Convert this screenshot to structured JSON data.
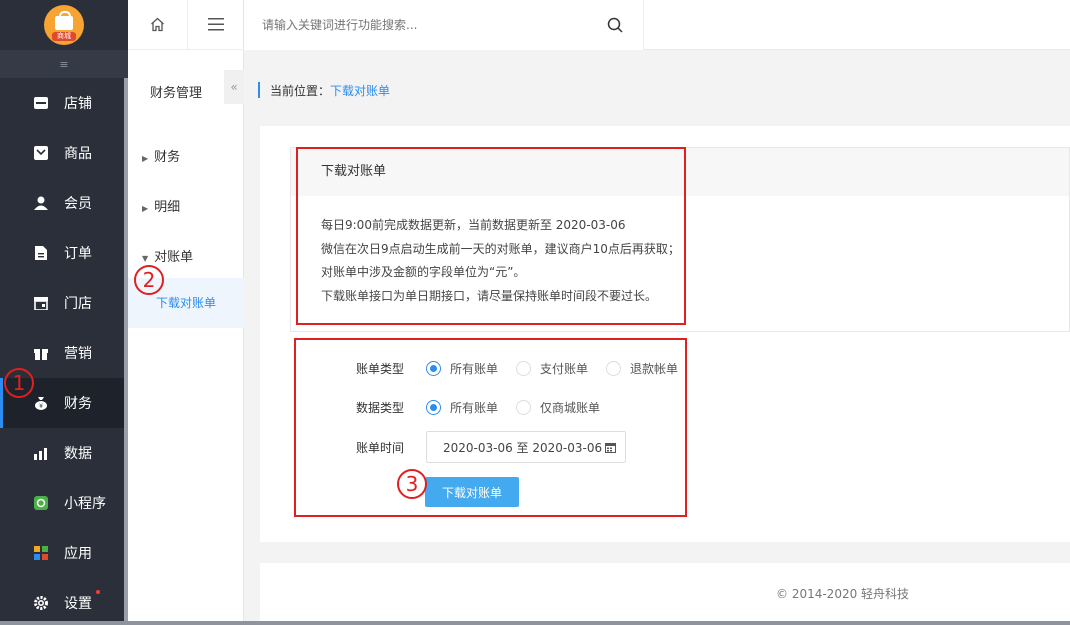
{
  "logo": {
    "tag": "商城"
  },
  "nav": {
    "collapse_icon": "≡",
    "items": [
      {
        "label": "店铺",
        "icon": "store-icon"
      },
      {
        "label": "商品",
        "icon": "goods-icon"
      },
      {
        "label": "会员",
        "icon": "user-icon"
      },
      {
        "label": "订单",
        "icon": "order-icon"
      },
      {
        "label": "门店",
        "icon": "shop-icon"
      },
      {
        "label": "营销",
        "icon": "gift-icon"
      },
      {
        "label": "财务",
        "icon": "money-bag-icon"
      },
      {
        "label": "数据",
        "icon": "chart-icon"
      },
      {
        "label": "小程序",
        "icon": "miniprogram-icon"
      },
      {
        "label": "应用",
        "icon": "apps-icon"
      },
      {
        "label": "设置",
        "icon": "gear-icon"
      }
    ]
  },
  "sub": {
    "title": "财务管理",
    "fold": "«",
    "groups": [
      "财务",
      "明细",
      "对账单"
    ],
    "active": "下载对账单"
  },
  "topbar": {
    "search_placeholder": "请输入关键词进行功能搜索..."
  },
  "breadcrumb": {
    "prefix": "当前位置：",
    "current": "下载对账单"
  },
  "notice": {
    "title": "下载对账单",
    "lines": [
      "每日9:00前完成数据更新，当前数据更新至 2020-03-06",
      "微信在次日9点启动生成前一天的对账单，建议商户10点后再获取；",
      "对账单中涉及金额的字段单位为“元”。",
      "下载账单接口为单日期接口，请尽量保持账单时间段不要过长。"
    ]
  },
  "form": {
    "bill_type_label": "账单类型",
    "bill_type_options": [
      "所有账单",
      "支付账单",
      "退款帐单"
    ],
    "data_type_label": "数据类型",
    "data_type_options": [
      "所有账单",
      "仅商城账单"
    ],
    "time_label": "账单时间",
    "time_value": "2020-03-06 至 2020-03-06",
    "download_label": "下载对账单"
  },
  "annotations": [
    "1",
    "2",
    "3"
  ],
  "footer": {
    "copyright": "© 2014-2020 轻舟科技"
  },
  "colors": {
    "accent": "#2d8cf0",
    "annotation": "#e02020",
    "nav_bg": "#2b2f3a"
  }
}
